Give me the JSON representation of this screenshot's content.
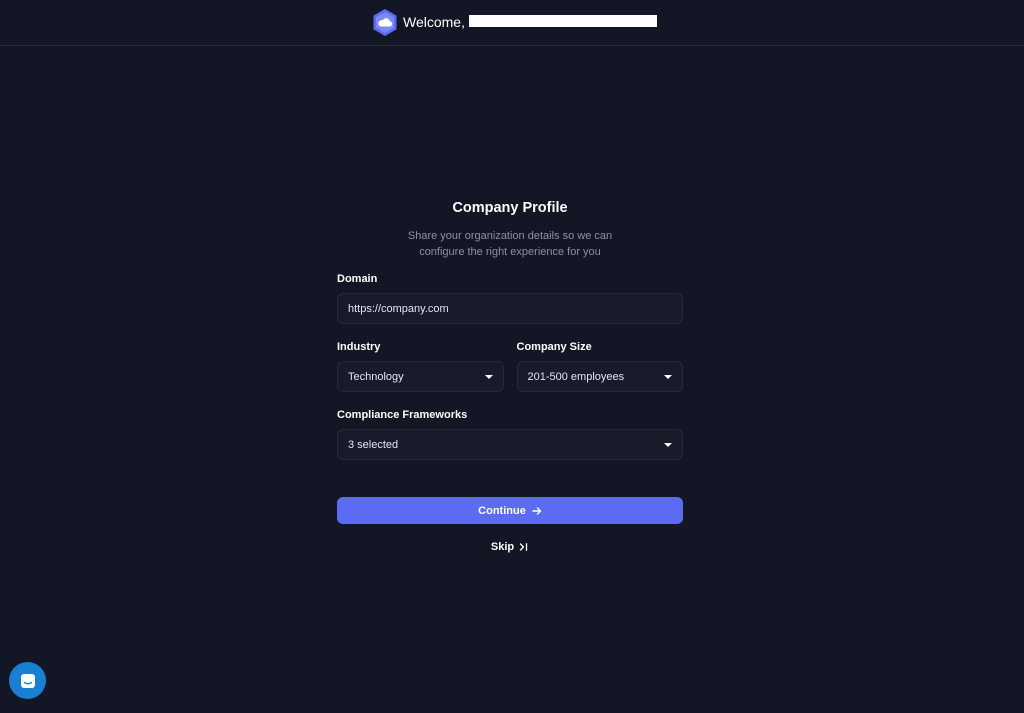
{
  "header": {
    "welcome_text": "Welcome,"
  },
  "form": {
    "title": "Company Profile",
    "subtitle_line1": "Share your organization details so we can",
    "subtitle_line2": "configure the right experience for you",
    "domain": {
      "label": "Domain",
      "value": "https://company.com"
    },
    "industry": {
      "label": "Industry",
      "value": "Technology"
    },
    "company_size": {
      "label": "Company Size",
      "value": "201-500 employees"
    },
    "compliance": {
      "label": "Compliance Frameworks",
      "value": "3 selected"
    },
    "continue_label": "Continue",
    "skip_label": "Skip"
  },
  "colors": {
    "background": "#131624",
    "field_background": "#181b2a",
    "accent": "#5b6cf2",
    "chat_launcher": "#1a7fd1"
  },
  "icons": {
    "logo": "hexagon-cloud-logo",
    "continue": "arrow-right-icon",
    "skip": "skip-to-end-icon",
    "chat": "chat-bubble-icon",
    "dropdown": "caret-down-icon"
  }
}
